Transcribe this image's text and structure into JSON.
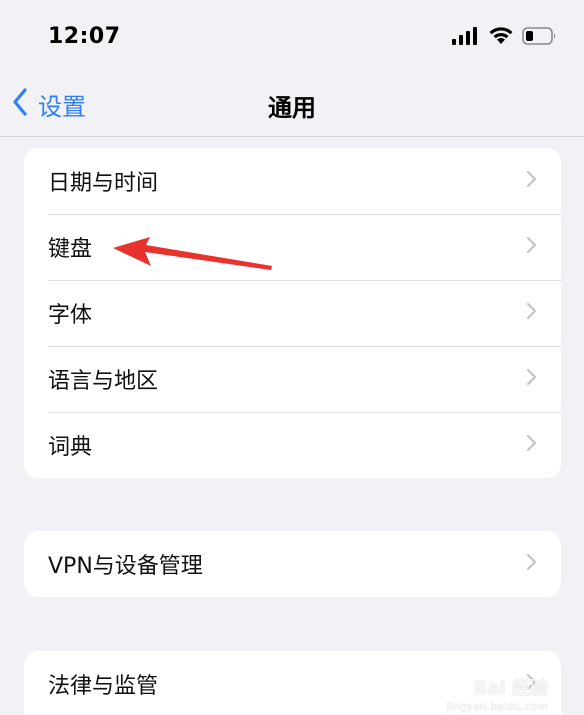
{
  "status_bar": {
    "time": "12:07",
    "icons": [
      "signal-icon",
      "wifi-icon",
      "battery-icon"
    ]
  },
  "nav": {
    "back_label": "设置",
    "title": "通用",
    "accent_color": "#2f7ff7"
  },
  "groups": [
    {
      "items": [
        {
          "label": "日期与时间"
        },
        {
          "label": "键盘"
        },
        {
          "label": "字体"
        },
        {
          "label": "语言与地区"
        },
        {
          "label": "词典"
        }
      ]
    },
    {
      "items": [
        {
          "label": "VPN与设备管理"
        }
      ]
    },
    {
      "items": [
        {
          "label": "法律与监管"
        }
      ]
    }
  ],
  "annotation": {
    "type": "red-arrow",
    "color": "#e8322e",
    "points_to": "键盘"
  },
  "watermark": {
    "logo": "Bai 经验",
    "site": "jingyan.baidu.com"
  }
}
